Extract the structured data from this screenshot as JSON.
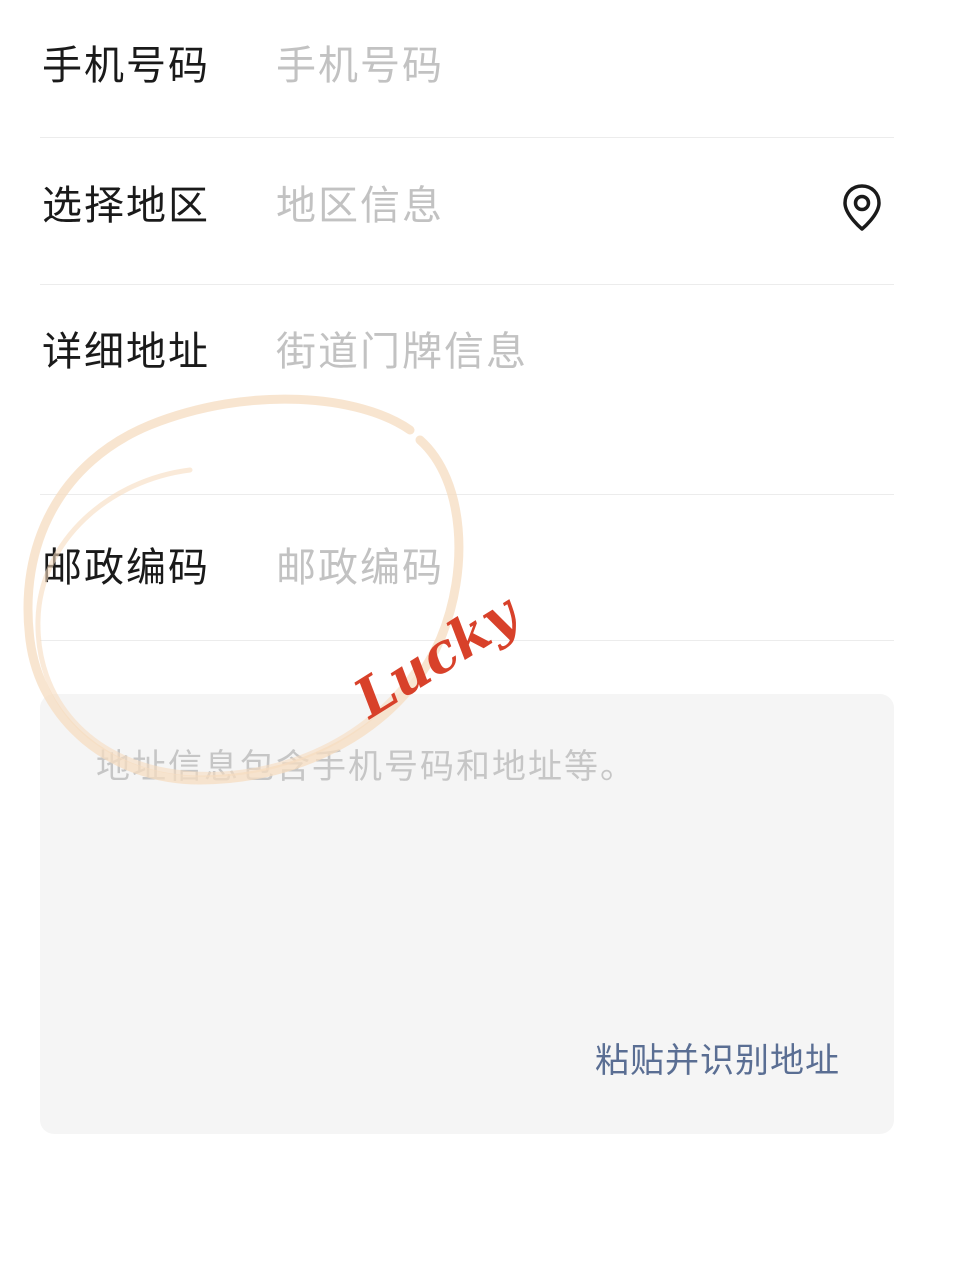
{
  "form": {
    "phone": {
      "label": "手机号码",
      "placeholder": "手机号码",
      "value": ""
    },
    "region": {
      "label": "选择地区",
      "placeholder": "地区信息",
      "value": "",
      "icon": "location-pin-icon"
    },
    "detail": {
      "label": "详细地址",
      "placeholder": "街道门牌信息",
      "value": ""
    },
    "postal": {
      "label": "邮政编码",
      "placeholder": "邮政编码",
      "value": ""
    }
  },
  "paste": {
    "placeholder": "地址信息包含手机号码和地址等。",
    "value": "",
    "action_label": "粘贴并识别地址"
  },
  "overlay": {
    "signature_text": "Lucky"
  },
  "colors": {
    "label": "#1a1a1a",
    "placeholder": "#c2c2c2",
    "divider": "#ececec",
    "box_bg": "#f5f5f5",
    "link": "#5a6e93",
    "circle_stroke": "#f6dcc0",
    "signature": "#d8412a"
  }
}
